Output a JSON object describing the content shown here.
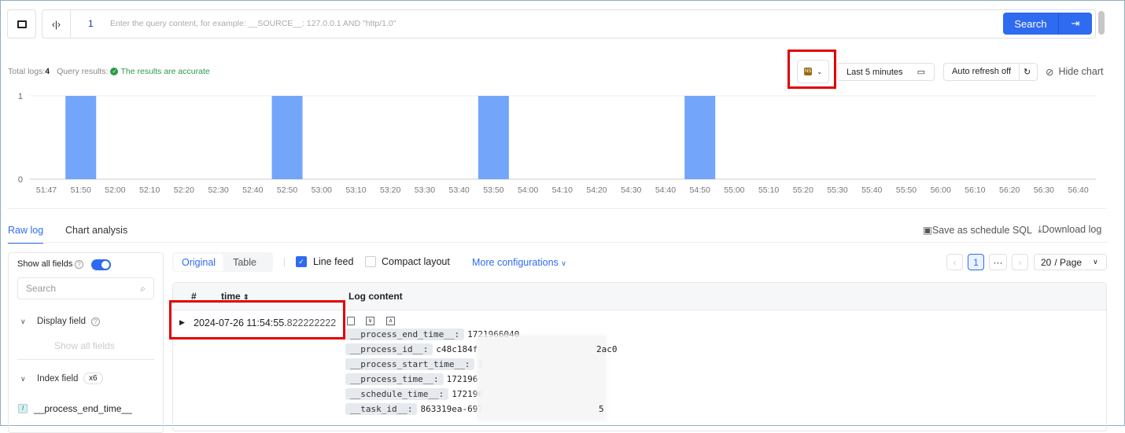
{
  "query": {
    "line_number": "1",
    "placeholder": "Enter the query content, for example: __SOURCE__: 127.0.0.1 AND \"http/1.0\"",
    "search_label": "Search"
  },
  "stats": {
    "total_label": "Total logs:",
    "total_value": "4",
    "query_label": "Query results:",
    "accuracy": "The results are accurate"
  },
  "toolbar": {
    "namespace_badge": "NS",
    "time_range": "Last 5 minutes",
    "auto_refresh": "Auto refresh off",
    "hide_chart": "Hide chart"
  },
  "colors": {
    "primary": "#2f6bf0",
    "bar": "#73a5fb",
    "success": "#2a9a4a",
    "highlight": "#e00000",
    "badge": "#9a6a14"
  },
  "chart_data": {
    "type": "bar",
    "categories": [
      "51:47",
      "51:50",
      "52:00",
      "52:10",
      "52:20",
      "52:30",
      "52:40",
      "52:50",
      "53:00",
      "53:10",
      "53:20",
      "53:30",
      "53:40",
      "53:50",
      "54:00",
      "54:10",
      "54:20",
      "54:30",
      "54:40",
      "54:50",
      "55:00",
      "55:10",
      "55:20",
      "55:30",
      "55:40",
      "55:50",
      "56:00",
      "56:10",
      "56:20",
      "56:30",
      "56:40"
    ],
    "values": [
      0,
      1,
      0,
      0,
      0,
      0,
      0,
      1,
      0,
      0,
      0,
      0,
      0,
      1,
      0,
      0,
      0,
      0,
      0,
      1,
      0,
      0,
      0,
      0,
      0,
      0,
      0,
      0,
      0,
      0,
      0
    ],
    "yticks": [
      "0",
      "1"
    ],
    "ylim": [
      0,
      1
    ],
    "grid": true
  },
  "tabs": {
    "raw_log": "Raw log",
    "chart_analysis": "Chart analysis",
    "save_sql": "Save as schedule SQL",
    "download": "Download log"
  },
  "sidebar": {
    "show_all_fields": "Show all fields",
    "search_placeholder": "Search",
    "display_field": "Display field",
    "show_all_fields_link": "Show all fields",
    "index_field": "Index field",
    "index_count": "x6",
    "fields": [
      "__process_end_time__"
    ]
  },
  "view": {
    "original": "Original",
    "table": "Table",
    "line_feed": "Line feed",
    "line_feed_checked": true,
    "compact": "Compact layout",
    "compact_checked": false,
    "more": "More configurations"
  },
  "pagination": {
    "current": "1",
    "ellipsis": "···",
    "page_size": "20",
    "page_suffix": "/ Page"
  },
  "table": {
    "col_index": "#",
    "col_time": "time",
    "col_content": "Log content",
    "rows": [
      {
        "time_main": "2024-07-26 11:54:55.",
        "time_frac": "822222222",
        "fields": [
          {
            "key": "__process_end_time__:",
            "value": "1721966040"
          },
          {
            "key": "__process_id__:",
            "value": "c48c184f-",
            "tail": "2ac0"
          },
          {
            "key": "__process_start_time__:",
            "value": "1"
          },
          {
            "key": "__process_time__:",
            "value": "172196"
          },
          {
            "key": "__schedule_time__:",
            "value": "172196"
          },
          {
            "key": "__task_id__:",
            "value": "863319ea-697",
            "tail": "5"
          }
        ]
      }
    ]
  }
}
